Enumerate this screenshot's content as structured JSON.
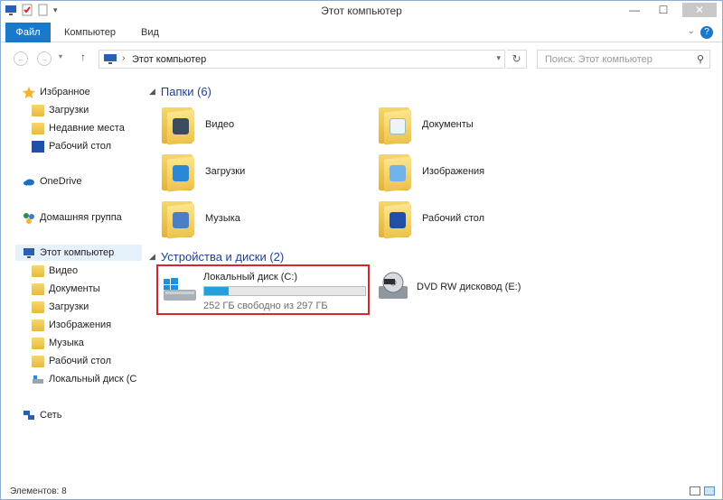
{
  "window": {
    "title": "Этот компьютер"
  },
  "ribbon": {
    "tabs": [
      "Файл",
      "Компьютер",
      "Вид"
    ],
    "help_label": "?"
  },
  "address": {
    "path": "Этот компьютер",
    "search_placeholder": "Поиск: Этот компьютер"
  },
  "sidebar": {
    "favorites": {
      "label": "Избранное",
      "items": [
        "Загрузки",
        "Недавние места",
        "Рабочий стол"
      ]
    },
    "onedrive": "OneDrive",
    "homegroup": "Домашняя группа",
    "thispc": {
      "label": "Этот компьютер",
      "items": [
        "Видео",
        "Документы",
        "Загрузки",
        "Изображения",
        "Музыка",
        "Рабочий стол",
        "Локальный диск (C"
      ]
    },
    "network": "Сеть"
  },
  "main": {
    "folders_header": "Папки (6)",
    "folders": [
      {
        "name": "Видео",
        "icon": "video-folder-icon"
      },
      {
        "name": "Документы",
        "icon": "documents-folder-icon"
      },
      {
        "name": "Загрузки",
        "icon": "downloads-folder-icon"
      },
      {
        "name": "Изображения",
        "icon": "pictures-folder-icon"
      },
      {
        "name": "Музыка",
        "icon": "music-folder-icon"
      },
      {
        "name": "Рабочий стол",
        "icon": "desktop-folder-icon"
      }
    ],
    "devices_header": "Устройства и диски (2)",
    "local_disk": {
      "name": "Локальный диск (C:)",
      "free": "252 ГБ свободно из 297 ГБ",
      "used_fraction": 0.15
    },
    "dvd": {
      "name": "DVD RW дисковод (E:)"
    }
  },
  "status": {
    "items": "Элементов: 8"
  },
  "colors": {
    "accent": "#1979ca",
    "highlight_border": "#d8262c",
    "header_blue": "#1e3f96",
    "progress": "#26a0da"
  }
}
